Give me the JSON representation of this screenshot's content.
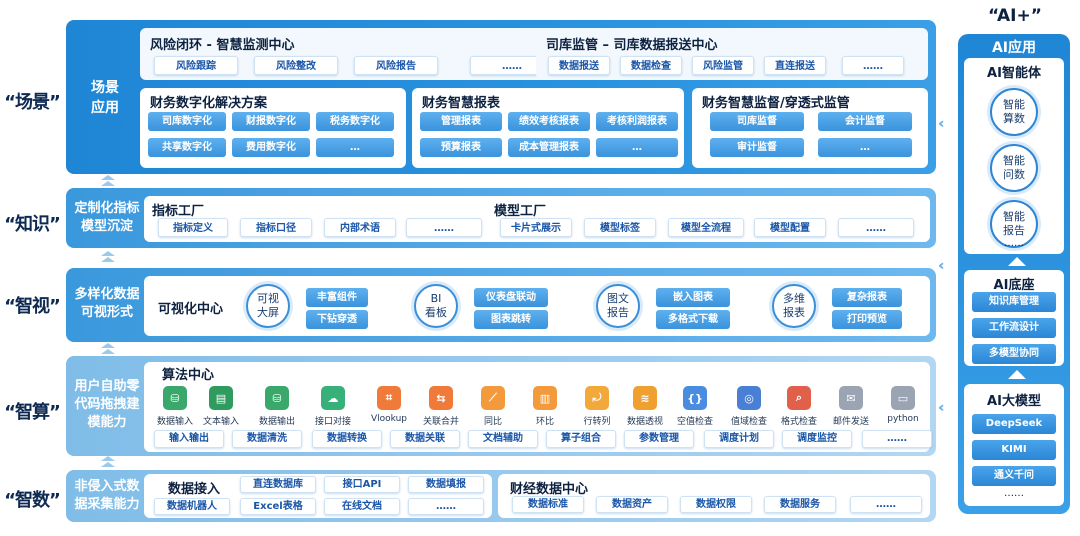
{
  "colors": {
    "accent": "#2a8fde",
    "light_band": "#9ccbee",
    "text_dark": "#0d2140"
  },
  "row_labels": [
    "“场景”",
    "“知识”",
    "“智视”",
    "“智算”",
    "“智数”"
  ],
  "ai_plus_label": "“AI+”",
  "scene": {
    "title_line1": "场景",
    "title_line2": "应用",
    "risk": {
      "title": "风险闭环 - 智慧监测中心",
      "items": [
        "风险跟踪",
        "风险整改",
        "风险报告",
        "……"
      ]
    },
    "treasury": {
      "title": "司库监管 – 司库数据报送中心",
      "items": [
        "数据报送",
        "数据检查",
        "风险监管",
        "直连报送",
        "……"
      ]
    },
    "digital": {
      "title": "财务数字化解决方案",
      "items": [
        "司库数字化",
        "财报数字化",
        "税务数字化",
        "共享数字化",
        "费用数字化",
        "…"
      ]
    },
    "smart_report": {
      "title": "财务智慧报表",
      "items": [
        "管理报表",
        "绩效考核报表",
        "考核利润报表",
        "预算报表",
        "成本管理报表",
        "…"
      ]
    },
    "supervision": {
      "title": "财务智慧监督/穿透式监管",
      "items": [
        "司库监督",
        "会计监督",
        "审计监督",
        "…"
      ]
    }
  },
  "knowledge": {
    "title_line1": "定制化指标",
    "title_line2": "模型沉淀",
    "indicator": {
      "title": "指标工厂",
      "items": [
        "指标定义",
        "指标口径",
        "内部术语",
        "……"
      ]
    },
    "model": {
      "title": "模型工厂",
      "items": [
        "卡片式展示",
        "模型标签",
        "模型全流程",
        "模型配置",
        "……"
      ]
    }
  },
  "vision": {
    "title_line1": "多样化数据",
    "title_line2": "可视形式",
    "center": "可视化中心",
    "groups": [
      {
        "circle1": "可视",
        "circle2": "大屏",
        "items": [
          "丰富组件",
          "下钻穿透"
        ]
      },
      {
        "circle1": "BI",
        "circle2": "看板",
        "items": [
          "仪表盘联动",
          "图表跳转"
        ]
      },
      {
        "circle1": "图文",
        "circle2": "报告",
        "items": [
          "嵌入图表",
          "多格式下载"
        ]
      },
      {
        "circle1": "多维",
        "circle2": "报表",
        "items": [
          "复杂报表",
          "打印预览"
        ]
      }
    ]
  },
  "compute": {
    "title_line1": "用户自助零",
    "title_line2": "代码拖拽建",
    "title_line3": "模能力",
    "center": "算法中心",
    "algos": [
      {
        "label": "数据输入",
        "icon": "database-icon",
        "color": "#3aa86a",
        "glyph": "⛁"
      },
      {
        "label": "文本输入",
        "icon": "text-input-icon",
        "color": "#2f9b5e",
        "glyph": "▤"
      },
      {
        "label": "数据输出",
        "icon": "database-out-icon",
        "color": "#3aa86a",
        "glyph": "⛁"
      },
      {
        "label": "接口对接",
        "icon": "cloud-icon",
        "color": "#38b07a",
        "glyph": "☁"
      },
      {
        "label": "Vlookup",
        "icon": "lookup-icon",
        "color": "#f07a3a",
        "glyph": "⌗"
      },
      {
        "label": "关联合并",
        "icon": "merge-icon",
        "color": "#f07a3a",
        "glyph": "⇆"
      },
      {
        "label": "同比",
        "icon": "line-chart-icon",
        "color": "#f39a3c",
        "glyph": "⟋"
      },
      {
        "label": "环比",
        "icon": "bar-chart-icon",
        "color": "#f39a3c",
        "glyph": "▥"
      },
      {
        "label": "行转列",
        "icon": "transpose-icon",
        "color": "#f3a83c",
        "glyph": "⤾"
      },
      {
        "label": "数据透视",
        "icon": "layers-icon",
        "color": "#f0a030",
        "glyph": "≋"
      },
      {
        "label": "空值检查",
        "icon": "null-check-icon",
        "color": "#4a8de0",
        "glyph": "{}"
      },
      {
        "label": "值域检查",
        "icon": "range-check-icon",
        "color": "#4a7fd6",
        "glyph": "◎"
      },
      {
        "label": "格式检查",
        "icon": "format-check-icon",
        "color": "#e0604a",
        "glyph": "⌕"
      },
      {
        "label": "邮件发送",
        "icon": "mail-icon",
        "color": "#9aa4b2",
        "glyph": "✉"
      },
      {
        "label": "python",
        "icon": "python-icon",
        "color": "#9aa4b2",
        "glyph": "▭"
      }
    ],
    "pills": [
      "输入输出",
      "数据清洗",
      "数据转换",
      "数据关联",
      "文档辅助",
      "算子组合",
      "参数管理",
      "调度计划",
      "调度监控",
      "……"
    ]
  },
  "data": {
    "title_line1": "非侵入式数",
    "title_line2": "据采集能力",
    "access": {
      "title": "数据接入",
      "row1": [
        "直连数据库",
        "接口API",
        "数据填报"
      ],
      "row2": [
        "数据机器人",
        "Excel表格",
        "在线文档",
        "……"
      ]
    },
    "finance": {
      "title": "财经数据中心",
      "items": [
        "数据标准",
        "数据资产",
        "数据权限",
        "数据服务",
        "……"
      ]
    }
  },
  "ai": {
    "header": "AI应用",
    "agent": {
      "title": "AI智能体",
      "circles": [
        [
          "智能",
          "算数"
        ],
        [
          "智能",
          "问数"
        ],
        [
          "智能",
          "报告"
        ]
      ],
      "more": "……"
    },
    "base": {
      "title": "AI底座",
      "items": [
        "知识库管理",
        "工作流设计",
        "多模型协同"
      ]
    },
    "llm": {
      "title": "AI大模型",
      "items": [
        "DeepSeek",
        "KIMI",
        "通义千问"
      ],
      "more": "……"
    }
  }
}
